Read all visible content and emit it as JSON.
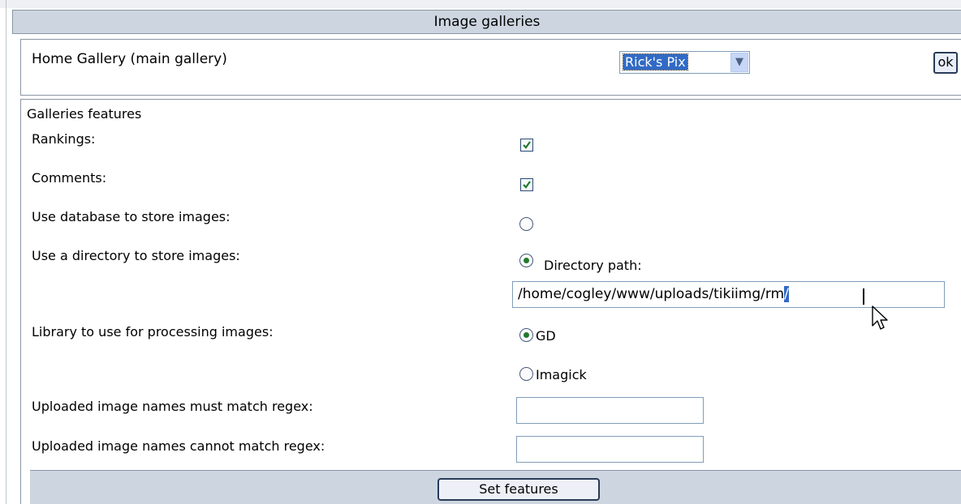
{
  "panel": {
    "title": "Image galleries"
  },
  "home_gallery": {
    "label": "Home Gallery (main gallery)",
    "selected": "Rick's Pix",
    "ok_label": "ok"
  },
  "features": {
    "section_title": "Galleries features",
    "rankings": {
      "label": "Rankings:",
      "checked": true
    },
    "comments": {
      "label": "Comments:",
      "checked": true
    },
    "use_database": {
      "label": "Use database to store images:",
      "selected": false
    },
    "use_directory": {
      "label": "Use a directory to store images:",
      "selected": true,
      "path_label": "Directory path:"
    },
    "directory_path": {
      "value_main": "/home/cogley/www/uploads/tikiimg/rm",
      "value_selected": "/"
    },
    "library": {
      "label": "Library to use for processing images:",
      "options": [
        {
          "label": "GD",
          "selected": true
        },
        {
          "label": "Imagick",
          "selected": false
        }
      ]
    },
    "must_match": {
      "label": "Uploaded image names must match regex:",
      "value": ""
    },
    "cannot_match": {
      "label": "Uploaded image names cannot match regex:",
      "value": ""
    },
    "submit_label": "Set features"
  },
  "colors": {
    "header_bg": "#cdd6e0",
    "border": "#8a96a3",
    "selection": "#316ac5",
    "check_green": "#1f7a2e"
  }
}
